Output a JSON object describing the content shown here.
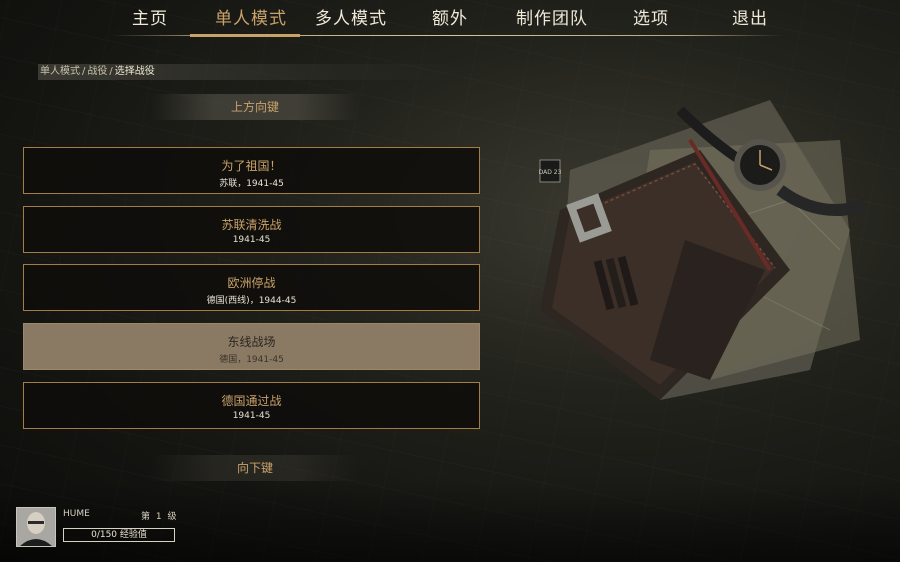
{
  "nav": {
    "items": [
      {
        "label": "主页"
      },
      {
        "label": "单人模式"
      },
      {
        "label": "多人模式"
      },
      {
        "label": "额外"
      },
      {
        "label": "制作团队"
      },
      {
        "label": "选项"
      },
      {
        "label": "退出"
      }
    ],
    "active_index": 1
  },
  "breadcrumb": {
    "items": [
      "单人模式",
      "/",
      "战役",
      "/",
      "选择战役"
    ]
  },
  "list": {
    "scroll_up_label": "上方向键",
    "scroll_down_label": "向下键",
    "campaigns": [
      {
        "title": "为了祖国！",
        "subtitle": "苏联，1941-45"
      },
      {
        "title": "苏联清洗战",
        "subtitle": "1941-45"
      },
      {
        "title": "欧洲停战",
        "subtitle": "德国(西线)，1944-45"
      },
      {
        "title": "东线战场",
        "subtitle": "德国，1941-45"
      },
      {
        "title": "德国通过战",
        "subtitle": "1941-45"
      }
    ],
    "selected_index": 3
  },
  "profile": {
    "name": "HUME",
    "level_text": "第 1 级",
    "xp_text": "0/150 经验值",
    "xp_progress": 0.0
  },
  "colors": {
    "accent": "#c9a26a",
    "selected_bg": "#8a7a63",
    "border": "#a47c45"
  },
  "artwork": {
    "label": "DAD 23"
  }
}
